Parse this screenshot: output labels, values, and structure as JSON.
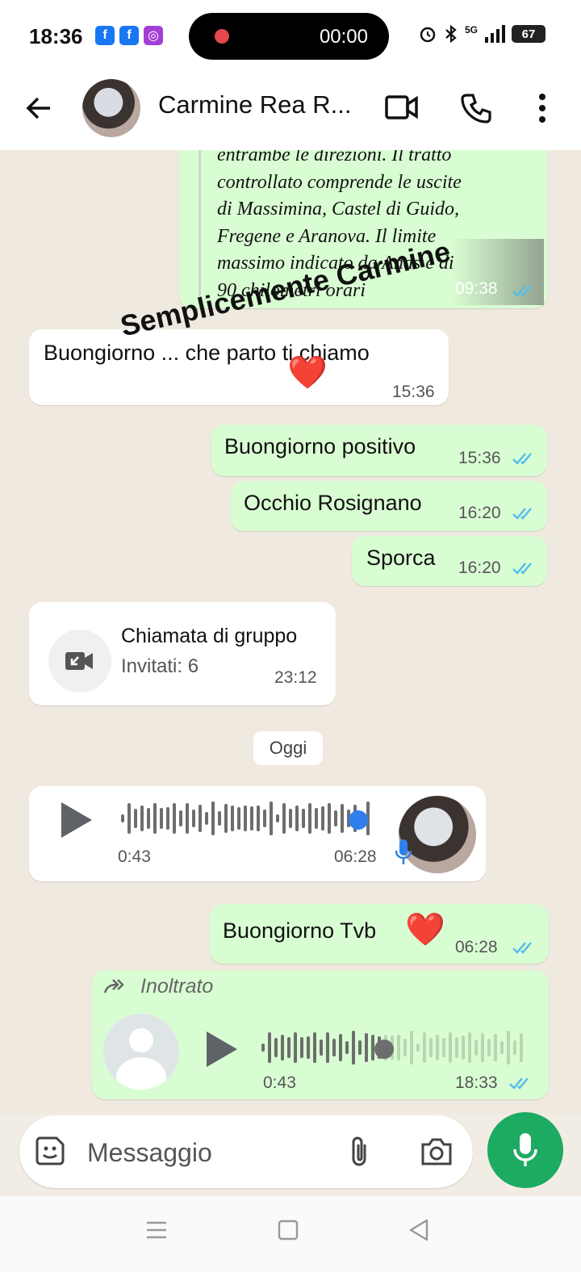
{
  "status_bar": {
    "time": "18:36",
    "app_icons": [
      "f",
      "f",
      "◎"
    ],
    "recording_time": "00:00",
    "network": "5G",
    "battery": "67"
  },
  "header": {
    "contact_name": "Carmine Rea R...",
    "avatar_icon": "contact-avatar",
    "actions": [
      "video-call-icon",
      "phone-icon",
      "more-vertical-icon"
    ]
  },
  "chat": {
    "news_excerpt": {
      "lines": [
        "entrambe le direzioni. Il tratto",
        "controllato comprende le uscite",
        "di Massimina, Castel di Guido,",
        "Fregene e Aranova. Il limite",
        "massimo indicato da Anas è di",
        "90 chilometri orari"
      ],
      "time": "09:38"
    },
    "watermark": "Semplicemente Carmine",
    "messages": [
      {
        "dir": "in",
        "text": "Buongiorno ... che parto ti chiamo",
        "emoji": "❤️",
        "time": "15:36"
      },
      {
        "dir": "out",
        "text": "Buongiorno positivo",
        "time": "15:36"
      },
      {
        "dir": "out",
        "text": "Occhio Rosignano",
        "time": "16:20"
      },
      {
        "dir": "out",
        "text": "Sporca",
        "time": "16:20"
      }
    ],
    "group_call": {
      "title": "Chiamata di gruppo",
      "subtitle": "Invitati: 6",
      "time": "23:12"
    },
    "date_separator": "Oggi",
    "voice_in": {
      "duration": "0:43",
      "time": "06:28",
      "progress": 0.93
    },
    "reply": {
      "text": "Buongiorno Tvb",
      "emoji": "❤️",
      "time": "06:28"
    },
    "voice_forwarded": {
      "label": "Inoltrato",
      "duration": "0:43",
      "time": "18:33",
      "progress": 0.46
    }
  },
  "composer": {
    "placeholder": "Messaggio",
    "icons": [
      "sticker-icon",
      "attach-icon",
      "camera-icon",
      "mic-icon"
    ]
  },
  "colors": {
    "outgoing_bubble": "#d9fdd3",
    "incoming_bubble": "#ffffff",
    "read_ticks": "#53bdeb",
    "accent_green": "#1daa61"
  }
}
